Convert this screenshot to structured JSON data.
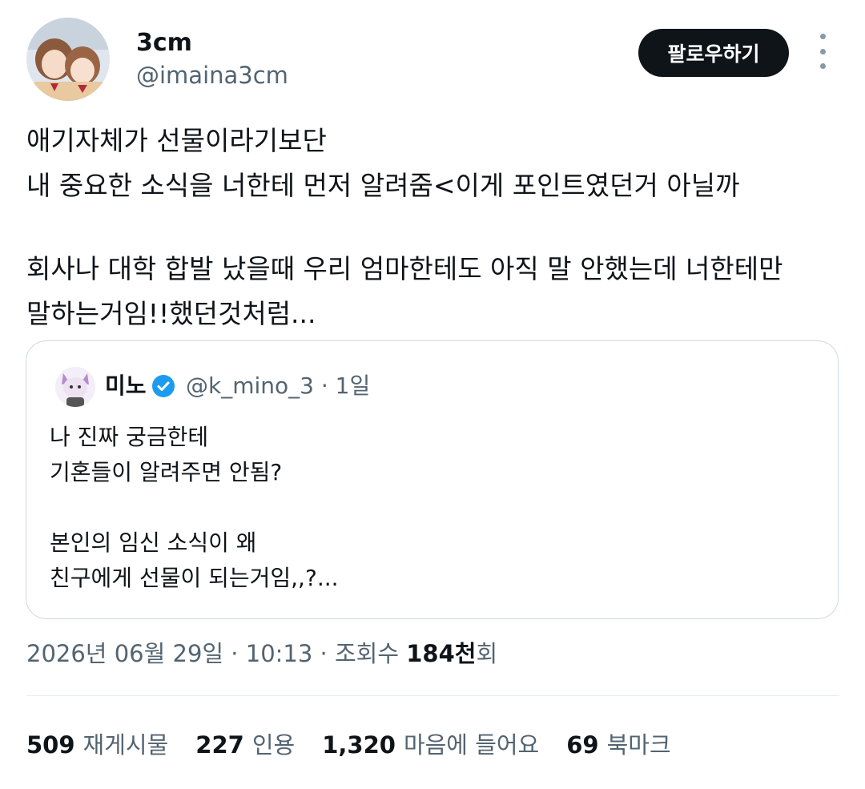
{
  "author": {
    "name": "3cm",
    "handle": "@imaina3cm",
    "follow_label": "팔로우하기"
  },
  "tweet": {
    "lines": [
      "애기자체가 선물이라기보단",
      "내 중요한 소식을 너한테 먼저 알려줌<이게 포인트였던거 아닐까",
      "회사나 대학 합발 났을때 우리 엄마한테도 아직 말 안했는데 너한테만",
      "말하는거임!!했던것처럼..."
    ]
  },
  "quote": {
    "name": "미노",
    "handle_time": "@k_mino_3 · 1일",
    "lines": [
      "나 진짜 궁금한테",
      "기혼들이 알려주면 안됨?",
      "본인의 임신 소식이 왜",
      "친구에게 선물이 되는거임,,?..."
    ]
  },
  "meta": {
    "datetime": "2026년 06월 29일 · 10:13 · 조회수 ",
    "views": "184천",
    "views_suffix": "회"
  },
  "stats": {
    "retweets": {
      "count": "509",
      "label": "재게시물"
    },
    "quotes": {
      "count": "227",
      "label": "인용"
    },
    "likes": {
      "count": "1,320",
      "label": "마음에 들어요"
    },
    "bookmarks": {
      "count": "69",
      "label": "북마크"
    }
  },
  "colors": {
    "text": "#0f1419",
    "secondary": "#536471",
    "border": "#cfd9de",
    "verified": "#1d9bf0",
    "button": "#0f1419"
  }
}
